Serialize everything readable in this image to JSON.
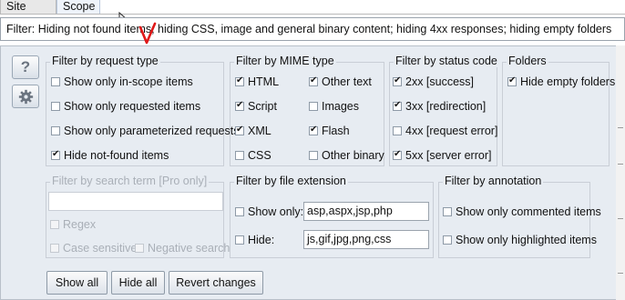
{
  "tabs": [
    {
      "label": "Site map",
      "active": true
    },
    {
      "label": "Scope",
      "active": false
    }
  ],
  "filter_summary": "Filter: Hiding not found items;  hiding CSS, image and general binary content;  hiding 4xx responses;  hiding empty folders",
  "side_buttons": {
    "help_glyph": "?",
    "settings_icon": "gear-icon"
  },
  "groups": {
    "request_type": {
      "title": "Filter by request type",
      "items": [
        {
          "label": "Show only in-scope items",
          "checked": false
        },
        {
          "label": "Show only requested items",
          "checked": false
        },
        {
          "label": "Show only parameterized requests",
          "checked": false
        },
        {
          "label": "Hide not-found items",
          "checked": true
        }
      ]
    },
    "mime_type": {
      "title": "Filter by MIME type",
      "items": [
        {
          "label": "HTML",
          "checked": true
        },
        {
          "label": "Other text",
          "checked": true
        },
        {
          "label": "Script",
          "checked": true
        },
        {
          "label": "Images",
          "checked": false
        },
        {
          "label": "XML",
          "checked": true
        },
        {
          "label": "Flash",
          "checked": true
        },
        {
          "label": "CSS",
          "checked": false
        },
        {
          "label": "Other binary",
          "checked": false
        }
      ]
    },
    "status_code": {
      "title": "Filter by status code",
      "items": [
        {
          "label": "2xx  [success]",
          "checked": true
        },
        {
          "label": "3xx  [redirection]",
          "checked": true
        },
        {
          "label": "4xx  [request error]",
          "checked": false
        },
        {
          "label": "5xx  [server error]",
          "checked": true
        }
      ]
    },
    "folders": {
      "title": "Folders",
      "items": [
        {
          "label": "Hide empty folders",
          "checked": true
        }
      ]
    },
    "search_term": {
      "title": "Filter by search term [Pro only]",
      "value": "",
      "items": [
        {
          "label": "Regex",
          "checked": false
        },
        {
          "label": "Case sensitive",
          "checked": false
        },
        {
          "label": "Negative search",
          "checked": false
        }
      ]
    },
    "file_extension": {
      "title": "Filter by file extension",
      "show_only": {
        "label": "Show only:",
        "checked": false,
        "value": "asp,aspx,jsp,php"
      },
      "hide": {
        "label": "Hide:",
        "checked": false,
        "value": "js,gif,jpg,png,css"
      }
    },
    "annotation": {
      "title": "Filter by annotation",
      "items": [
        {
          "label": "Show only commented items",
          "checked": false
        },
        {
          "label": "Show only highlighted items",
          "checked": false
        }
      ]
    }
  },
  "buttons": {
    "show_all": "Show all",
    "hide_all": "Hide all",
    "revert": "Revert changes"
  },
  "colors": {
    "annotation_mark": "#e01818",
    "panel_bg": "#e7ecf2"
  }
}
